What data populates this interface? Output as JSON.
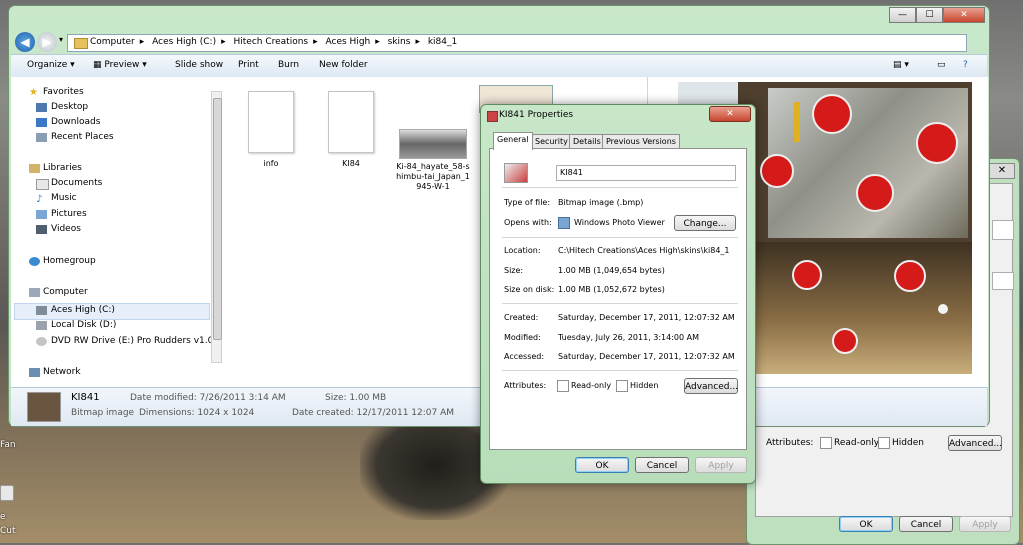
{
  "explorer": {
    "address": [
      "Computer",
      "Aces High (C:)",
      "Hitech Creations",
      "Aces High",
      "skins",
      "ki84_1"
    ],
    "window_buttons": [
      "—",
      "☐",
      "✕"
    ],
    "toolbar": [
      "Organize ▾",
      "Preview ▾",
      "Slide show",
      "Print",
      "Burn",
      "New folder"
    ],
    "sidebar": {
      "favorites": {
        "label": "Favorites",
        "items": [
          "Desktop",
          "Downloads",
          "Recent Places"
        ]
      },
      "libraries": {
        "label": "Libraries",
        "items": [
          "Documents",
          "Music",
          "Pictures",
          "Videos"
        ]
      },
      "homegroup": "Homegroup",
      "computer": {
        "label": "Computer",
        "items": [
          "Aces High (C:)",
          "Local Disk (D:)",
          "DVD RW Drive (E:) Pro Rudders v1.0"
        ]
      },
      "network": "Network"
    },
    "files": [
      "info",
      "KI84",
      "Ki-84_hayate_58-shimbu-tai_Japan_1945-W-1"
    ],
    "details": {
      "name": "KI841",
      "type": "Bitmap image",
      "date_modified": "Date modified: 7/26/2011 3:14 AM",
      "dimensions": "Dimensions: 1024 x 1024",
      "size": "Size: 1.00 MB",
      "date_created": "Date created: 12/17/2011 12:07 AM"
    }
  },
  "properties": {
    "title": "KI841 Properties",
    "close": "✕",
    "tabs": [
      "General",
      "Security",
      "Details",
      "Previous Versions"
    ],
    "name_value": "KI841",
    "type_label": "Type of file:",
    "type_value": "Bitmap image (.bmp)",
    "opens_label": "Opens with:",
    "opens_value": "Windows Photo Viewer",
    "change_btn": "Change...",
    "location_label": "Location:",
    "location_value": "C:\\Hitech Creations\\Aces High\\skins\\ki84_1",
    "size_label": "Size:",
    "size_value": "1.00 MB (1,049,654 bytes)",
    "sizedisk_label": "Size on disk:",
    "sizedisk_value": "1.00 MB (1,052,672 bytes)",
    "created_label": "Created:",
    "created_value": "Saturday, December 17, 2011, 12:07:32 AM",
    "modified_label": "Modified:",
    "modified_value": "Tuesday, July 26, 2011, 3:14:00 AM",
    "accessed_label": "Accessed:",
    "accessed_value": "Saturday, December 17, 2011, 12:07:32 AM",
    "attributes_label": "Attributes:",
    "readonly": "Read-only",
    "hidden": "Hidden",
    "advanced_btn": "Advanced...",
    "ok": "OK",
    "cancel": "Cancel",
    "apply": "Apply"
  },
  "back_dialog": {
    "close": "✕",
    "attributes_label": "Attributes:",
    "readonly": "Read-only",
    "hidden": "Hidden",
    "advanced_btn": "Advanced...",
    "ok": "OK",
    "cancel": "Cancel",
    "apply": "Apply"
  },
  "desktop": {
    "label_a": "Fan",
    "label_b": "e",
    "label_c": "Cut"
  }
}
